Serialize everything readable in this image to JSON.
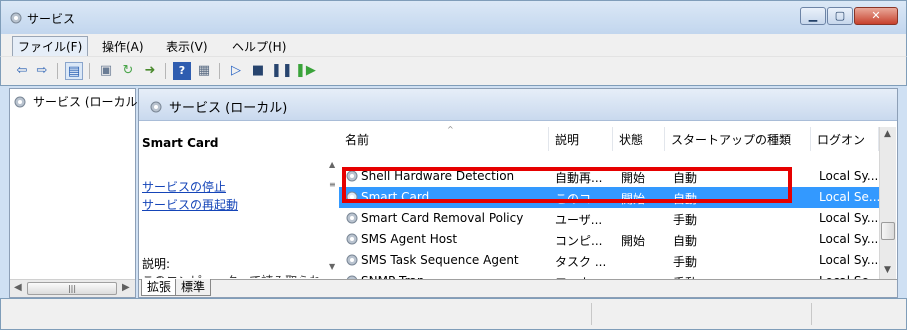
{
  "window": {
    "title": "サービス"
  },
  "menu": [
    "ファイル(F)",
    "操作(A)",
    "表示(V)",
    "ヘルプ(H)"
  ],
  "tree": {
    "root_label": "サービス (ローカル)"
  },
  "panel": {
    "header": "サービス (ローカル)"
  },
  "detail": {
    "service_name": "Smart Card",
    "stop_link": "サービスの停止",
    "restart_link": "サービスの再起動",
    "description_label": "説明:",
    "description_cut": "このコンピューターで読み取られ"
  },
  "columns": [
    "名前",
    "説明",
    "状態",
    "スタートアップの種類",
    "ログオン"
  ],
  "rows": [
    {
      "name": "Shell Hardware Detection",
      "desc": "自動再...",
      "status": "開始",
      "startup": "自動",
      "logon": "Local Sy...",
      "selected": false
    },
    {
      "name": "Smart Card",
      "desc": "このコ...",
      "status": "開始",
      "startup": "自動",
      "logon": "Local Se...",
      "selected": true
    },
    {
      "name": "Smart Card Removal Policy",
      "desc": "ユーザ...",
      "status": "",
      "startup": "手動",
      "logon": "Local Sy...",
      "selected": false
    },
    {
      "name": "SMS Agent Host",
      "desc": "コンピ...",
      "status": "開始",
      "startup": "自動",
      "logon": "Local Sy...",
      "selected": false
    },
    {
      "name": "SMS Task Sequence Agent",
      "desc": "タスク ...",
      "status": "",
      "startup": "手動",
      "logon": "Local Sy...",
      "selected": false
    },
    {
      "name": "SNMP Trap",
      "desc": "ローカ...",
      "status": "",
      "startup": "手動",
      "logon": "Local Se...",
      "selected": false
    }
  ],
  "tabs": [
    "拡張",
    "標準"
  ],
  "colors": {
    "selection": "#3399ff",
    "highlight_box": "#e60000",
    "link": "#1545b8"
  }
}
